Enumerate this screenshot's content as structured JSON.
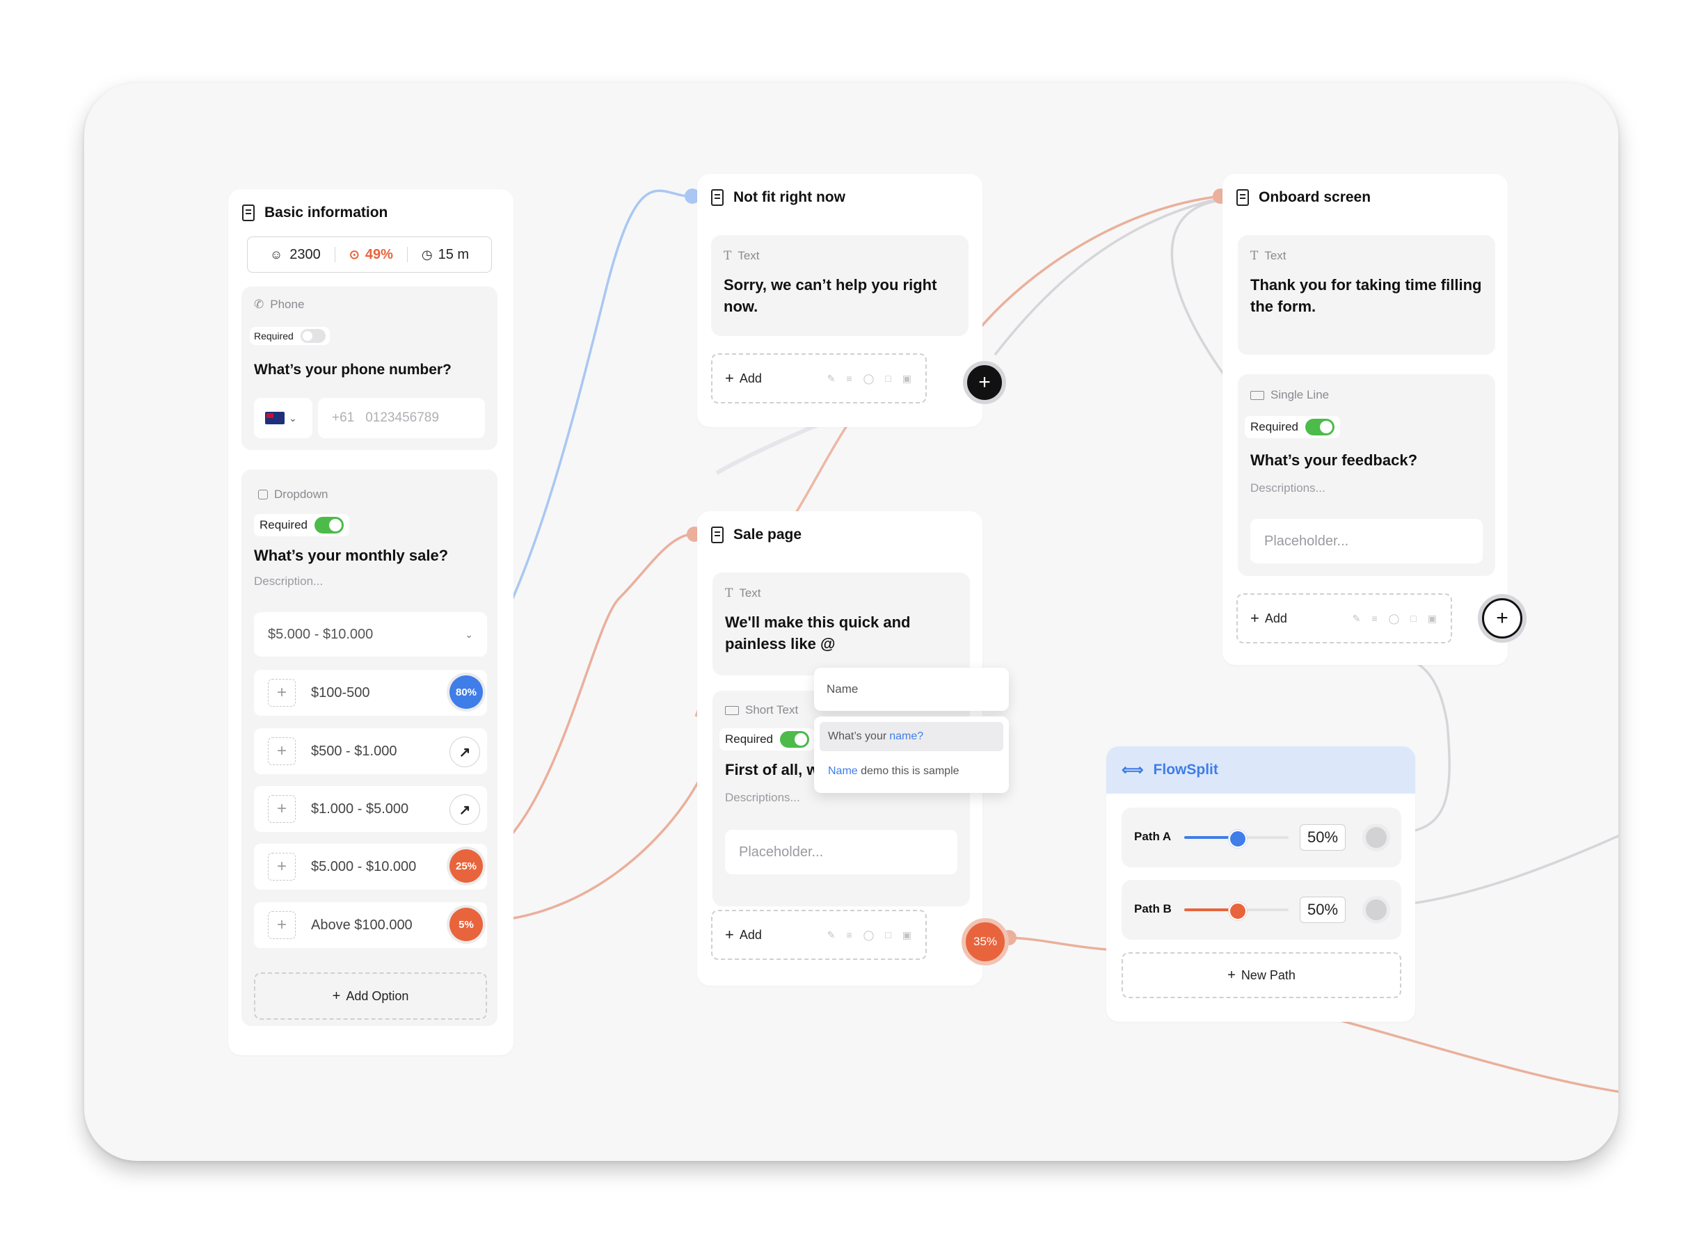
{
  "colors": {
    "blue": "#3f7de8",
    "orange": "#e8643c",
    "green": "#4cbb4a",
    "wire_gray": "#d2d2d5",
    "flow_header": "#dce8fa"
  },
  "basic_info": {
    "title": "Basic information",
    "stats": {
      "users": "2300",
      "rate": "49%",
      "time": "15 m"
    },
    "phone": {
      "type_label": "Phone",
      "required_label": "Required",
      "required_on": false,
      "question": "What’s your phone number?",
      "placeholder_prefix": "+61",
      "placeholder": "0123456789"
    },
    "dropdown": {
      "type_label": "Dropdown",
      "required_label": "Required",
      "required_on": true,
      "question": "What’s your monthly sale?",
      "description": "Description...",
      "selected": "$5.000 - $10.000",
      "options": [
        {
          "label": "$100-500",
          "badge": "80%",
          "kind": "blue"
        },
        {
          "label": "$500 - $1.000",
          "badge": "",
          "kind": "link"
        },
        {
          "label": "$1.000 - $5.000",
          "badge": "",
          "kind": "link"
        },
        {
          "label": "$5.000 - $10.000",
          "badge": "25%",
          "kind": "orange"
        },
        {
          "label": "Above $100.000",
          "badge": "5%",
          "kind": "orange"
        }
      ],
      "add_option_label": "Add Option"
    }
  },
  "not_fit": {
    "title": "Not fit right now",
    "text_label": "Text",
    "text_body": "Sorry, we can’t help you right now.",
    "add_label": "Add"
  },
  "sale_page": {
    "title": "Sale page",
    "text_label": "Text",
    "text_body": "We'll make this quick and painless like @",
    "short_label": "Short Text",
    "required_label": "Required",
    "question": "First of all, w",
    "description": "Descriptions...",
    "placeholder": "Placeholder...",
    "add_label": "Add",
    "badge": "35%",
    "mention_popup": {
      "header": "Name",
      "item1_prefix": "What’s your ",
      "item1_link": "name",
      "item1_suffix": "?",
      "item2_link": "Name",
      "item2_rest": " demo this is sample"
    }
  },
  "onboard": {
    "title": "Onboard screen",
    "text_label": "Text",
    "text_body": "Thank you for taking time filling the form.",
    "single_label": "Single Line",
    "required_label": "Required",
    "question": "What’s your feedback?",
    "description": "Descriptions...",
    "placeholder": "Placeholder...",
    "add_label": "Add"
  },
  "flowsplit": {
    "title": "FlowSplit",
    "paths": [
      {
        "name": "Path A",
        "value": "50%",
        "fraction": 0.5,
        "color": "#3f7de8"
      },
      {
        "name": "Path B",
        "value": "50%",
        "fraction": 0.5,
        "color": "#e8643c"
      }
    ],
    "new_path_label": "New Path"
  }
}
